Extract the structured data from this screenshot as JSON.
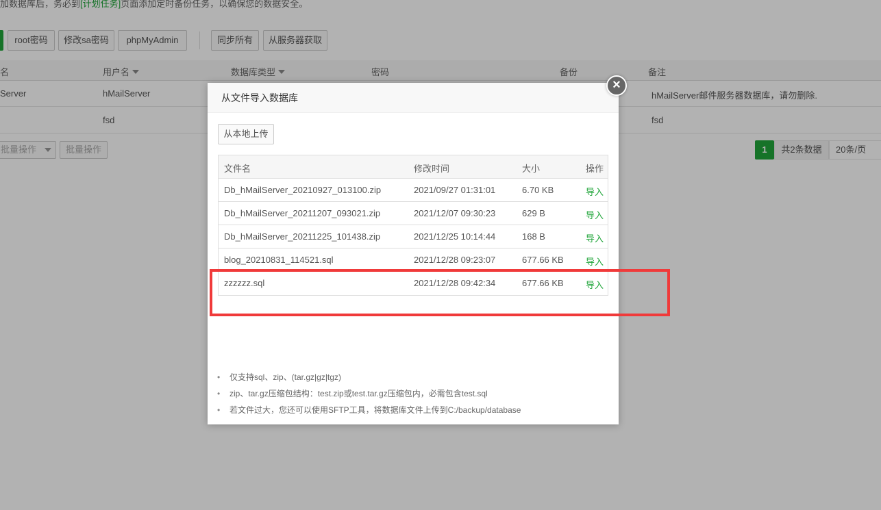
{
  "notice": {
    "prefix": "加数据库后，务必到",
    "link": "[计划任务]",
    "suffix": "页面添加定时备份任务，以确保您的数据安全。"
  },
  "toolbar": {
    "buttons": [
      "root密码",
      "修改sa密码",
      "phpMyAdmin",
      "同步所有",
      "从服务器获取"
    ]
  },
  "table": {
    "headers": [
      "名",
      "用户名",
      "数据库类型",
      "密码",
      "备份",
      "备注"
    ],
    "rows": [
      {
        "name": "Server",
        "user": "hMailServer",
        "note": "hMailServer邮件服务器数据库，请勿删除."
      },
      {
        "name": "",
        "user": "fsd",
        "note": "fsd"
      }
    ]
  },
  "footer": {
    "batch_select": "批量操作",
    "batch_button": "批量操作",
    "page": "1",
    "total": "共2条数据",
    "page_size": "20条/页"
  },
  "modal": {
    "title": "从文件导入数据库",
    "close_glyph": "×",
    "upload_label": "从本地上传",
    "columns": [
      "文件名",
      "修改时间",
      "大小",
      "操作"
    ],
    "files": [
      {
        "name": "Db_hMailServer_20210927_013100.zip",
        "time": "2021/09/27 01:31:01",
        "size": "6.70 KB",
        "op": "导入"
      },
      {
        "name": "Db_hMailServer_20211207_093021.zip",
        "time": "2021/12/07 09:30:23",
        "size": "629 B",
        "op": "导入"
      },
      {
        "name": "Db_hMailServer_20211225_101438.zip",
        "time": "2021/12/25 10:14:44",
        "size": "168 B",
        "op": "导入"
      },
      {
        "name": "blog_20210831_114521.sql",
        "time": "2021/12/28 09:23:07",
        "size": "677.66 KB",
        "op": "导入"
      },
      {
        "name": "zzzzzz.sql",
        "time": "2021/12/28 09:42:34",
        "size": "677.66 KB",
        "op": "导入"
      }
    ],
    "tips": [
      "仅支持sql、zip、(tar.gz|gz|tgz)",
      "zip、tar.gz压缩包结构：test.zip或test.tar.gz压缩包内，必需包含test.sql",
      "若文件过大，您还可以使用SFTP工具，将数据库文件上传到C:/backup/database"
    ]
  },
  "colors": {
    "accent": "#20a53a",
    "highlight": "#f03a3a"
  }
}
